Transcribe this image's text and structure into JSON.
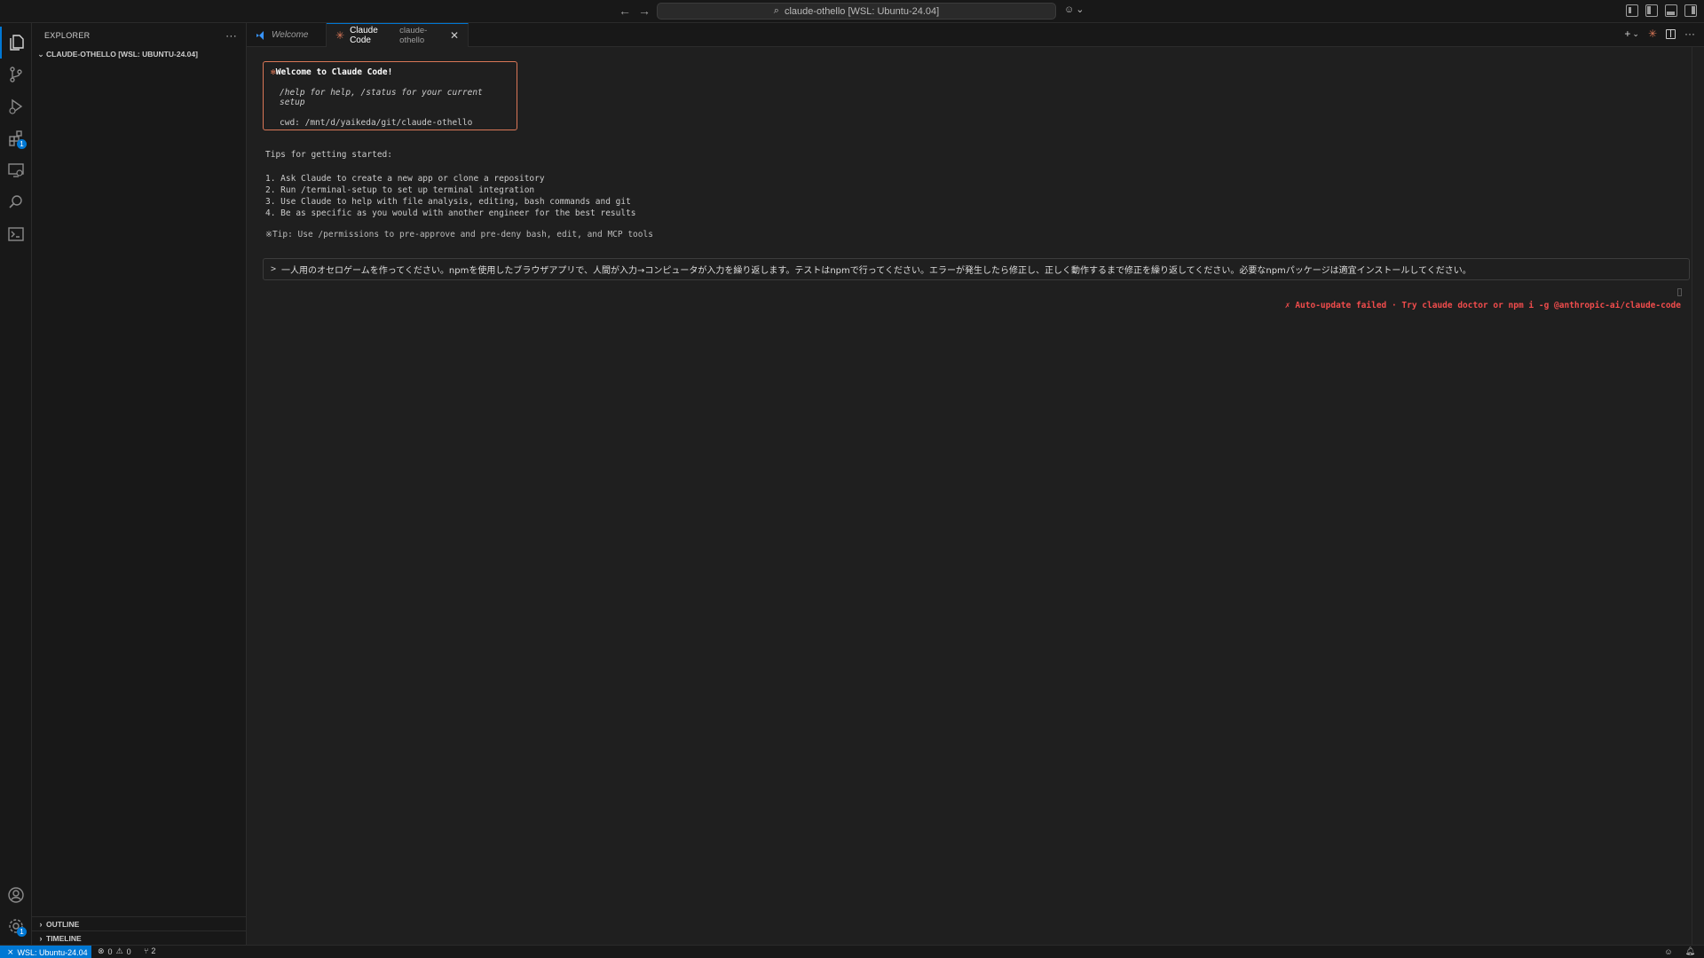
{
  "titlebar": {
    "back_icon": "arrow-left-icon",
    "forward_icon": "arrow-right-icon",
    "command_center": "claude-othello [WSL: Ubuntu-24.04]",
    "copilot_icon": "copilot-icon",
    "layout_icons": [
      "customize-layout-icon",
      "toggle-primary-sidebar-icon",
      "toggle-panel-icon",
      "toggle-secondary-sidebar-icon"
    ]
  },
  "activitybar": {
    "items": [
      {
        "name": "explorer",
        "icon": "files-icon",
        "active": true
      },
      {
        "name": "source-control",
        "icon": "source-control-icon"
      },
      {
        "name": "run-debug",
        "icon": "run-debug-icon"
      },
      {
        "name": "extensions",
        "icon": "extensions-icon",
        "badge": "1"
      },
      {
        "name": "remote-explorer",
        "icon": "remote-explorer-icon"
      },
      {
        "name": "search",
        "icon": "search-icon"
      },
      {
        "name": "terminal",
        "icon": "terminal-icon"
      }
    ],
    "accounts_icon": "account-icon",
    "manage_icon": "gear-icon",
    "manage_badge": "1"
  },
  "sidebar": {
    "title": "EXPLORER",
    "more": "···",
    "folder": "CLAUDE-OTHELLO [WSL: UBUNTU-24.04]",
    "outline": "OUTLINE",
    "timeline": "TIMELINE"
  },
  "tabs": [
    {
      "label": "Welcome"
    },
    {
      "label": "Claude Code",
      "sublabel": "claude-othello",
      "close": "✕"
    }
  ],
  "tab_actions": {
    "new": "+",
    "dropdown": "⌄",
    "claude_icon": "claude-icon",
    "split_icon": "split-editor-icon",
    "more": "···"
  },
  "terminal": {
    "welcome_title": "Welcome to Claude Code!",
    "welcome_help": "/help for help, /status for your current setup",
    "welcome_cwd": "cwd: /mnt/d/yaikeda/git/claude-othello",
    "tips_title": "Tips for getting started:",
    "tips": [
      "1. Ask Claude to create a new app or clone a repository",
      "2. Run /terminal-setup to set up terminal integration",
      "3. Use Claude to help with file analysis, editing, bash commands and git",
      "4. Be as specific as you would with another engineer for the best results"
    ],
    "tip_note": "※Tip: Use /permissions to pre-approve and pre-deny bash, edit, and MCP tools",
    "prompt_caret": ">",
    "prompt_text": "一人用のオセロゲームを作ってください。npmを使用したブラウザアプリで、人間が入力→コンピュータが入力を繰り返します。テストはnpmで行ってください。エラーが発生したら修正し、正しく動作するまで修正を繰り返してください。必要なnpmパッケージは適宜インストールしてください。",
    "error": "✗ Auto-update failed · Try claude doctor or npm i -g @anthropic-ai/claude-code"
  },
  "statusbar": {
    "remote": "WSL: Ubuntu-24.04",
    "errors": "0",
    "warnings": "0",
    "ports": "2",
    "right_icons": [
      "copilot-icon",
      "bell-icon"
    ]
  },
  "colors": {
    "accent": "#0078d4",
    "claude": "#d97757",
    "error": "#f14c4c",
    "background": "#1f1f1f",
    "sidebar": "#181818"
  }
}
